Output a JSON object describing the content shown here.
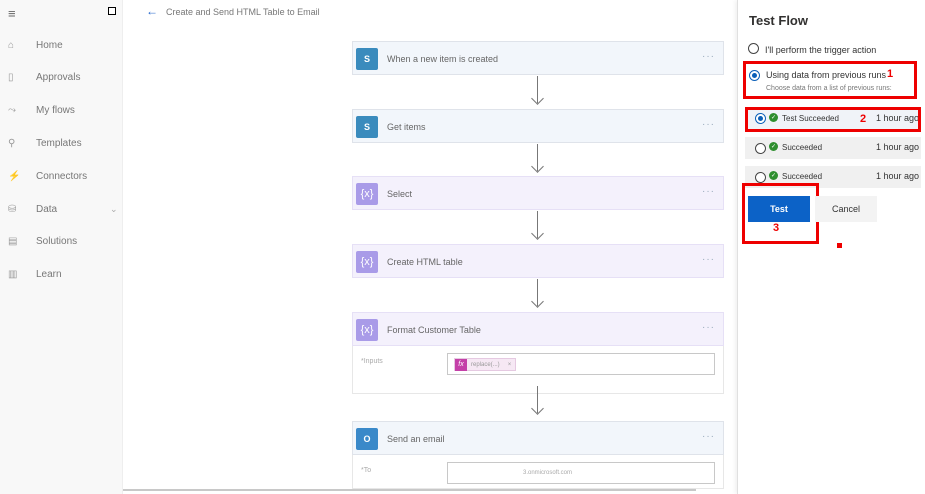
{
  "nav": {
    "items": [
      {
        "icon": "home-icon",
        "glyph": "⌂",
        "label": "Home"
      },
      {
        "icon": "approvals-icon",
        "glyph": "▯",
        "label": "Approvals"
      },
      {
        "icon": "flows-icon",
        "glyph": "⤳",
        "label": "My flows"
      },
      {
        "icon": "templates-icon",
        "glyph": "⚲",
        "label": "Templates"
      },
      {
        "icon": "connectors-icon",
        "glyph": "⚡",
        "label": "Connectors"
      },
      {
        "icon": "data-icon",
        "glyph": "⛁",
        "label": "Data"
      },
      {
        "icon": "solutions-icon",
        "glyph": "▤",
        "label": "Solutions"
      },
      {
        "icon": "learn-icon",
        "glyph": "▥",
        "label": "Learn"
      }
    ]
  },
  "header": {
    "title": "Create and Send HTML Table to Email"
  },
  "flow": {
    "steps": [
      {
        "title": "When a new item is created",
        "icon": "sharepoint-icon",
        "glyph": "S"
      },
      {
        "title": "Get items",
        "icon": "sharepoint-icon",
        "glyph": "S"
      },
      {
        "title": "Select",
        "icon": "variable-icon",
        "glyph": "{x}"
      },
      {
        "title": "Create HTML table",
        "icon": "variable-icon",
        "glyph": "{x}"
      },
      {
        "title": "Format Customer Table",
        "icon": "variable-icon",
        "glyph": "{x}"
      },
      {
        "title": "Send an email",
        "icon": "outlook-icon",
        "glyph": "O"
      }
    ],
    "more": "···",
    "compose_field_label": "*Inputs",
    "compose_token": "replace(...)",
    "compose_token_close": "×",
    "fx": "fx",
    "email_to_label": "*To",
    "email_to_value": "3.onmicrosoft.com"
  },
  "panel": {
    "title": "Test Flow",
    "option_manual": "I'll perform the trigger action",
    "option_previous": "Using data from previous runs",
    "option_previous_sub": "Choose data from a list of previous runs:",
    "runs": [
      {
        "status": "Test Succeeded",
        "time": "1 hour ago",
        "selected": true
      },
      {
        "status": "Succeeded",
        "time": "1 hour ago",
        "selected": false
      },
      {
        "status": "Succeeded",
        "time": "1 hour ago",
        "selected": false
      }
    ],
    "test_label": "Test",
    "cancel_label": "Cancel",
    "annotations": [
      "1",
      "2",
      "3"
    ],
    "annotation_color": "#ee0000",
    "accent_color": "#0c62c7"
  }
}
